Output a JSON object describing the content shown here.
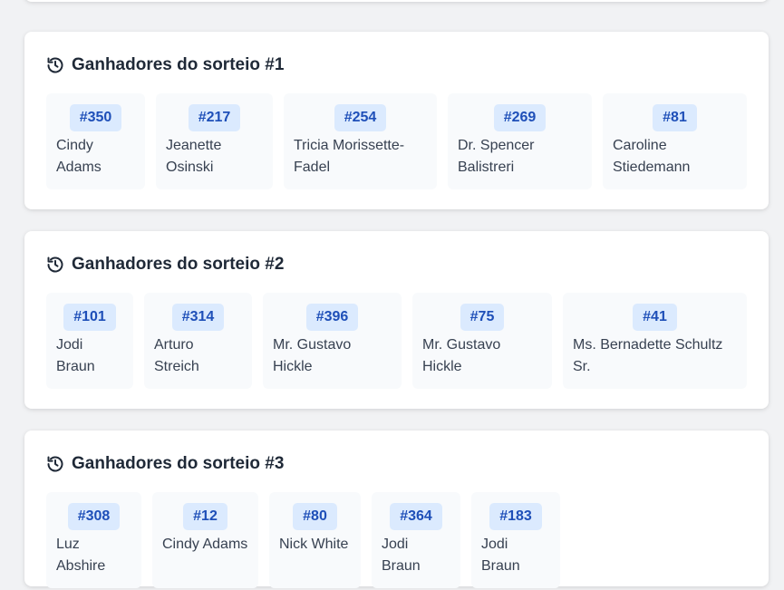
{
  "draws": [
    {
      "title": "Ganhadores do sorteio #1",
      "winners": [
        {
          "ticket": "#350",
          "name": "Cindy Adams"
        },
        {
          "ticket": "#217",
          "name": "Jeanette Osinski"
        },
        {
          "ticket": "#254",
          "name": "Tricia Morissette-Fadel"
        },
        {
          "ticket": "#269",
          "name": "Dr. Spencer Balistreri"
        },
        {
          "ticket": "#81",
          "name": "Caroline Stiedemann"
        }
      ]
    },
    {
      "title": "Ganhadores do sorteio #2",
      "winners": [
        {
          "ticket": "#101",
          "name": "Jodi Braun"
        },
        {
          "ticket": "#314",
          "name": "Arturo Streich"
        },
        {
          "ticket": "#396",
          "name": "Mr. Gustavo Hickle"
        },
        {
          "ticket": "#75",
          "name": "Mr. Gustavo Hickle"
        },
        {
          "ticket": "#41",
          "name": "Ms. Bernadette Schultz Sr."
        }
      ]
    },
    {
      "title": "Ganhadores do sorteio #3",
      "winners": [
        {
          "ticket": "#308",
          "name": "Luz Abshire"
        },
        {
          "ticket": "#12",
          "name": "Cindy Adams"
        },
        {
          "ticket": "#80",
          "name": "Nick White"
        },
        {
          "ticket": "#364",
          "name": "Jodi Braun"
        },
        {
          "ticket": "#183",
          "name": "Jodi Braun"
        }
      ]
    }
  ],
  "icons": {
    "title_icon": "history-icon"
  },
  "colors": {
    "ticket_bg": "#dbeafe",
    "ticket_text": "#1e4fb8"
  }
}
